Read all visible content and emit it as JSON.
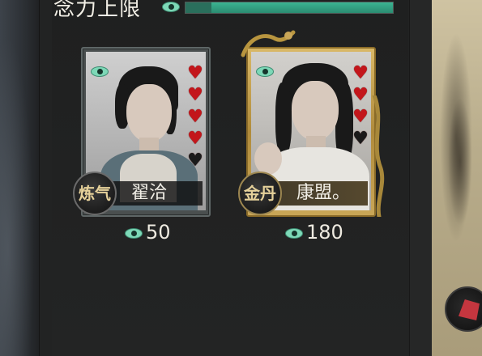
{
  "header": {
    "title": "念力上限",
    "eye_icon": "eye-icon",
    "limit_progress": 1.0
  },
  "cards": [
    {
      "name": "翟洽",
      "rank": "炼气",
      "hearts": {
        "filled": 4,
        "total": 5
      },
      "value": "50",
      "frame": "silver"
    },
    {
      "name": "康盟。",
      "rank": "金丹",
      "hearts": {
        "filled": 3,
        "total": 4
      },
      "value": "180",
      "frame": "gold"
    }
  ],
  "colors": {
    "accent": "#3bb391",
    "heart": "#c3161b",
    "gold": "#d9b867"
  }
}
